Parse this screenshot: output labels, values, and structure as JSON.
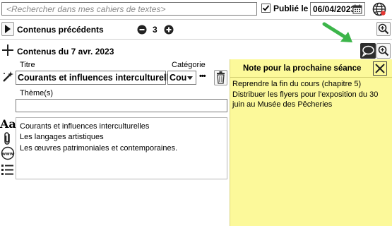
{
  "search": {
    "placeholder": "<Rechercher dans mes cahiers de textes>"
  },
  "publish": {
    "label": "Publié le",
    "checked": true,
    "date": "06/04/2023"
  },
  "previous": {
    "label": "Contenus précédents",
    "count": "3"
  },
  "current": {
    "label": "Contenus du 7 avr. 2023"
  },
  "form": {
    "title_label": "Titre",
    "title_value": "Courants et influences interculturelles",
    "category_label": "Catégorie",
    "category_value": "Cou",
    "more_label": "•••",
    "theme_label": "Thème(s)",
    "theme_value": ""
  },
  "content_lines": [
    "Courants et influences interculturelles",
    "Les langages artistiques",
    "Les œuvres patrimoniales et contemporaines."
  ],
  "note": {
    "title": "Note pour la prochaine séance",
    "lines": [
      "Reprendre la fin du cours (chapitre 5)",
      "Distribuer les flyers pour l'exposition du 30",
      "juin au Musée des Pêcheries"
    ]
  },
  "colors": {
    "note_bg": "#fcf99a",
    "arrow": "#3cb54a",
    "accent": "#2d2d2d"
  }
}
